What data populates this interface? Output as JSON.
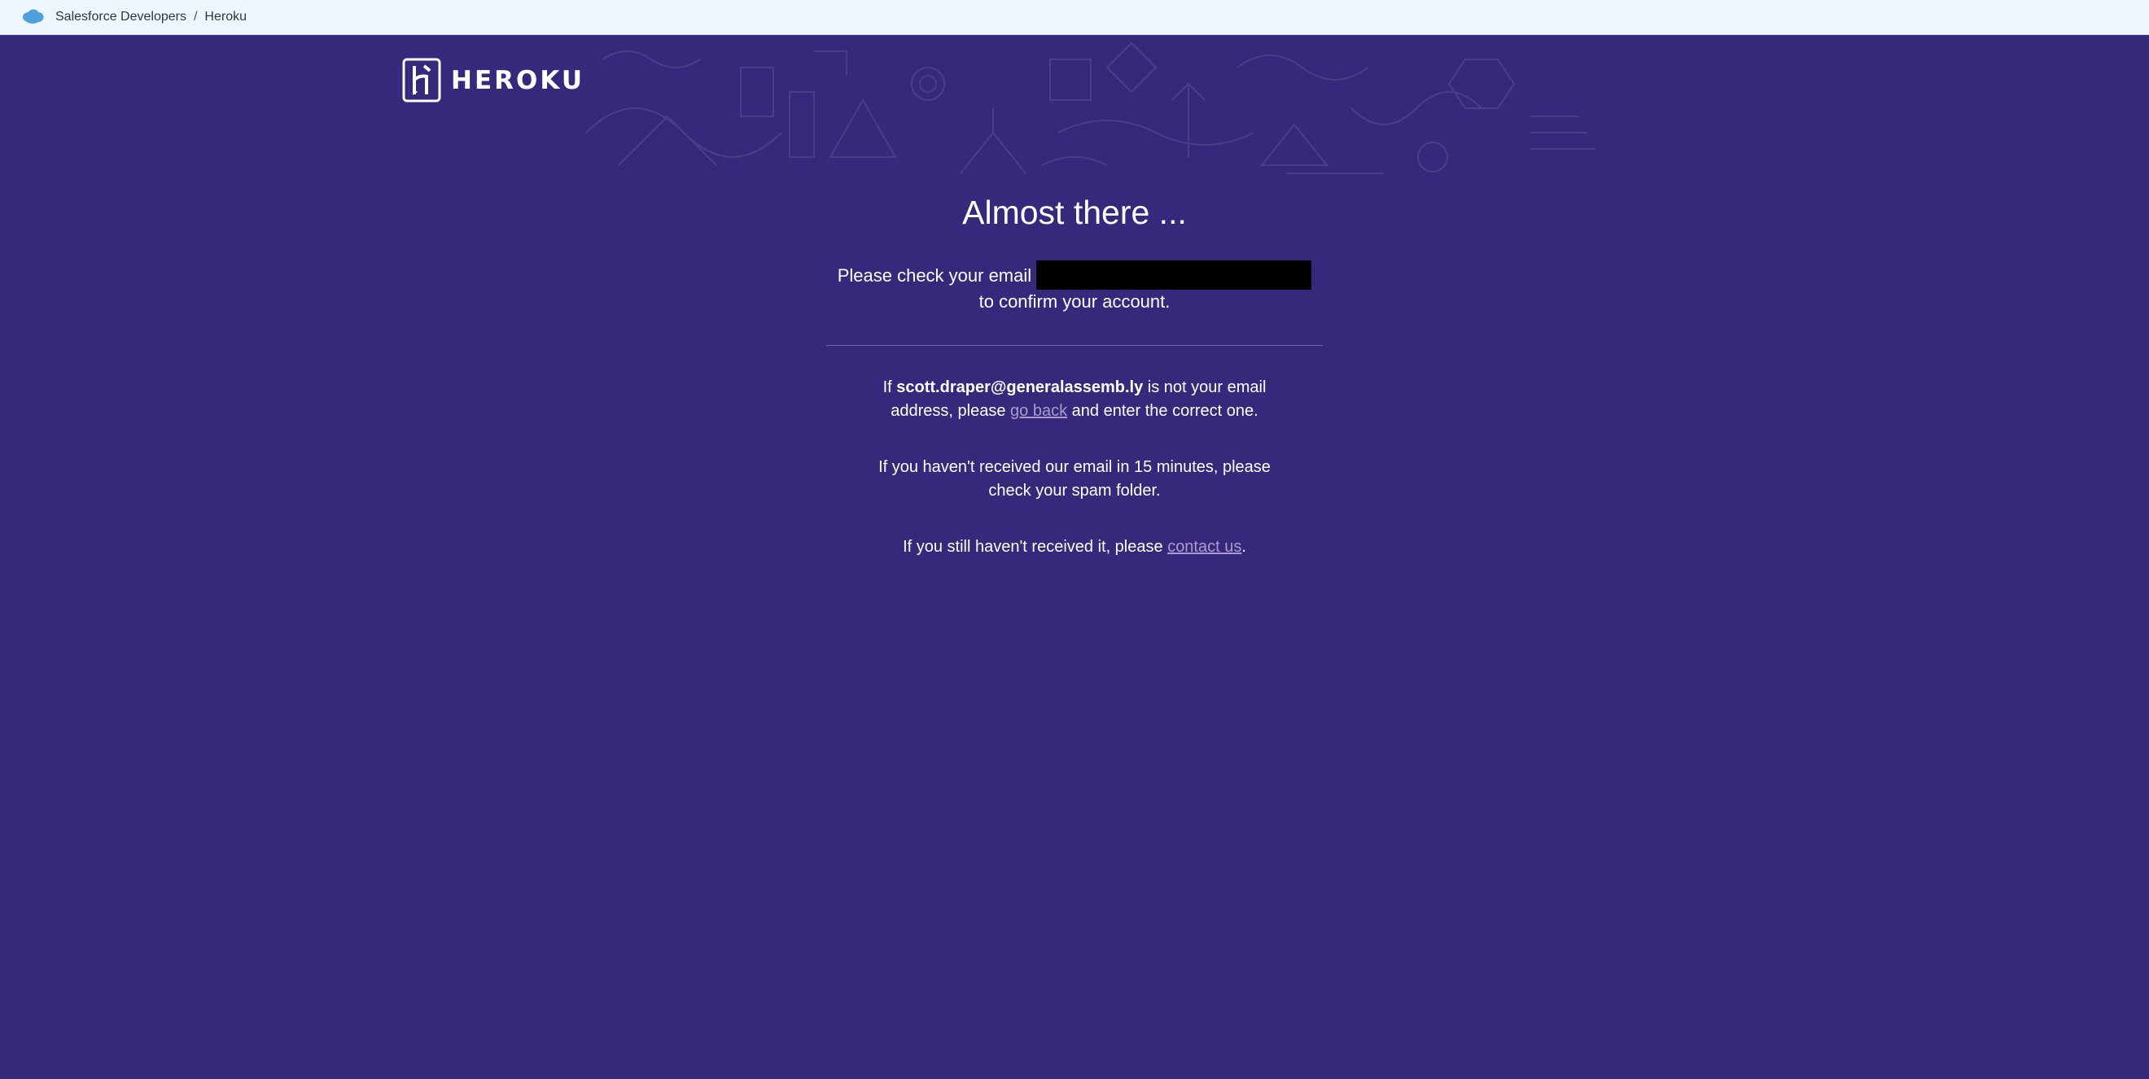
{
  "breadcrumb": {
    "parent": "Salesforce Developers",
    "separator": "/",
    "current": "Heroku"
  },
  "header": {
    "logo_text": "HEROKU"
  },
  "main": {
    "title": "Almost there ...",
    "check_prefix": "Please check your email",
    "check_suffix": "to confirm your account.",
    "wrong_email_prefix": "If",
    "email": "scott.draper@generalassemb.ly",
    "wrong_email_middle": "is not your email address, please",
    "go_back_link": "go back",
    "wrong_email_suffix": "and enter the correct one.",
    "spam_notice": "If you haven't received our email in 15 minutes, please check your spam folder.",
    "contact_prefix": "If you still haven't received it, please",
    "contact_link": "contact us",
    "contact_suffix": "."
  },
  "colors": {
    "background": "#36287a",
    "topbar": "#f0f6fd",
    "link": "#a89cd2",
    "salesforce_cloud": "#4da0db"
  }
}
